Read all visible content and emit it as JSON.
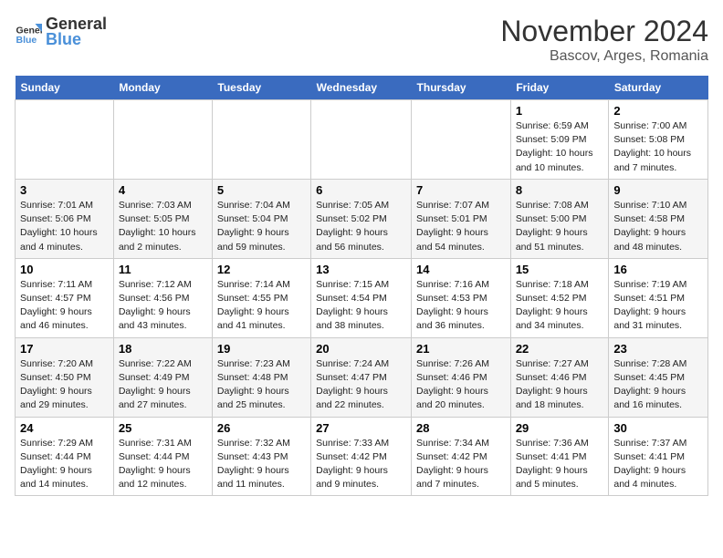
{
  "logo": {
    "line1": "General",
    "line2": "Blue"
  },
  "title": "November 2024",
  "subtitle": "Bascov, Arges, Romania",
  "weekdays": [
    "Sunday",
    "Monday",
    "Tuesday",
    "Wednesday",
    "Thursday",
    "Friday",
    "Saturday"
  ],
  "weeks": [
    [
      {
        "day": "",
        "info": ""
      },
      {
        "day": "",
        "info": ""
      },
      {
        "day": "",
        "info": ""
      },
      {
        "day": "",
        "info": ""
      },
      {
        "day": "",
        "info": ""
      },
      {
        "day": "1",
        "info": "Sunrise: 6:59 AM\nSunset: 5:09 PM\nDaylight: 10 hours and 10 minutes."
      },
      {
        "day": "2",
        "info": "Sunrise: 7:00 AM\nSunset: 5:08 PM\nDaylight: 10 hours and 7 minutes."
      }
    ],
    [
      {
        "day": "3",
        "info": "Sunrise: 7:01 AM\nSunset: 5:06 PM\nDaylight: 10 hours and 4 minutes."
      },
      {
        "day": "4",
        "info": "Sunrise: 7:03 AM\nSunset: 5:05 PM\nDaylight: 10 hours and 2 minutes."
      },
      {
        "day": "5",
        "info": "Sunrise: 7:04 AM\nSunset: 5:04 PM\nDaylight: 9 hours and 59 minutes."
      },
      {
        "day": "6",
        "info": "Sunrise: 7:05 AM\nSunset: 5:02 PM\nDaylight: 9 hours and 56 minutes."
      },
      {
        "day": "7",
        "info": "Sunrise: 7:07 AM\nSunset: 5:01 PM\nDaylight: 9 hours and 54 minutes."
      },
      {
        "day": "8",
        "info": "Sunrise: 7:08 AM\nSunset: 5:00 PM\nDaylight: 9 hours and 51 minutes."
      },
      {
        "day": "9",
        "info": "Sunrise: 7:10 AM\nSunset: 4:58 PM\nDaylight: 9 hours and 48 minutes."
      }
    ],
    [
      {
        "day": "10",
        "info": "Sunrise: 7:11 AM\nSunset: 4:57 PM\nDaylight: 9 hours and 46 minutes."
      },
      {
        "day": "11",
        "info": "Sunrise: 7:12 AM\nSunset: 4:56 PM\nDaylight: 9 hours and 43 minutes."
      },
      {
        "day": "12",
        "info": "Sunrise: 7:14 AM\nSunset: 4:55 PM\nDaylight: 9 hours and 41 minutes."
      },
      {
        "day": "13",
        "info": "Sunrise: 7:15 AM\nSunset: 4:54 PM\nDaylight: 9 hours and 38 minutes."
      },
      {
        "day": "14",
        "info": "Sunrise: 7:16 AM\nSunset: 4:53 PM\nDaylight: 9 hours and 36 minutes."
      },
      {
        "day": "15",
        "info": "Sunrise: 7:18 AM\nSunset: 4:52 PM\nDaylight: 9 hours and 34 minutes."
      },
      {
        "day": "16",
        "info": "Sunrise: 7:19 AM\nSunset: 4:51 PM\nDaylight: 9 hours and 31 minutes."
      }
    ],
    [
      {
        "day": "17",
        "info": "Sunrise: 7:20 AM\nSunset: 4:50 PM\nDaylight: 9 hours and 29 minutes."
      },
      {
        "day": "18",
        "info": "Sunrise: 7:22 AM\nSunset: 4:49 PM\nDaylight: 9 hours and 27 minutes."
      },
      {
        "day": "19",
        "info": "Sunrise: 7:23 AM\nSunset: 4:48 PM\nDaylight: 9 hours and 25 minutes."
      },
      {
        "day": "20",
        "info": "Sunrise: 7:24 AM\nSunset: 4:47 PM\nDaylight: 9 hours and 22 minutes."
      },
      {
        "day": "21",
        "info": "Sunrise: 7:26 AM\nSunset: 4:46 PM\nDaylight: 9 hours and 20 minutes."
      },
      {
        "day": "22",
        "info": "Sunrise: 7:27 AM\nSunset: 4:46 PM\nDaylight: 9 hours and 18 minutes."
      },
      {
        "day": "23",
        "info": "Sunrise: 7:28 AM\nSunset: 4:45 PM\nDaylight: 9 hours and 16 minutes."
      }
    ],
    [
      {
        "day": "24",
        "info": "Sunrise: 7:29 AM\nSunset: 4:44 PM\nDaylight: 9 hours and 14 minutes."
      },
      {
        "day": "25",
        "info": "Sunrise: 7:31 AM\nSunset: 4:44 PM\nDaylight: 9 hours and 12 minutes."
      },
      {
        "day": "26",
        "info": "Sunrise: 7:32 AM\nSunset: 4:43 PM\nDaylight: 9 hours and 11 minutes."
      },
      {
        "day": "27",
        "info": "Sunrise: 7:33 AM\nSunset: 4:42 PM\nDaylight: 9 hours and 9 minutes."
      },
      {
        "day": "28",
        "info": "Sunrise: 7:34 AM\nSunset: 4:42 PM\nDaylight: 9 hours and 7 minutes."
      },
      {
        "day": "29",
        "info": "Sunrise: 7:36 AM\nSunset: 4:41 PM\nDaylight: 9 hours and 5 minutes."
      },
      {
        "day": "30",
        "info": "Sunrise: 7:37 AM\nSunset: 4:41 PM\nDaylight: 9 hours and 4 minutes."
      }
    ]
  ]
}
